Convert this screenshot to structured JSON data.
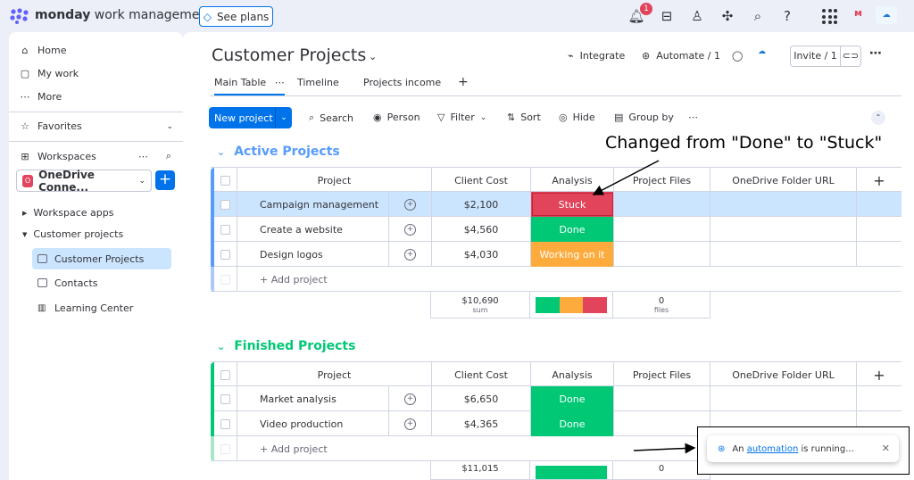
{
  "topbar": {
    "brand_bold": "monday",
    "brand_rest": " work management",
    "see_plans": "See plans",
    "notification_count": "1",
    "icons": [
      "bell-icon",
      "inbox-icon",
      "invite-members-icon",
      "apps-icon",
      "search-icon",
      "help-icon",
      "app-grid-icon"
    ]
  },
  "sidebar": {
    "home": "Home",
    "my_work": "My work",
    "more": "More",
    "favorites": "Favorites",
    "workspaces": "Workspaces",
    "workspace_name": "OneDrive Conne...",
    "workspace_badge": "O",
    "tree": {
      "workspace_apps": "Workspace apps",
      "customer_projects_folder": "Customer projects"
    },
    "boards": [
      "Customer Projects",
      "Contacts",
      "Learning Center"
    ]
  },
  "board": {
    "title": "Customer Projects",
    "integrate": "Integrate",
    "automate": "Automate / 1",
    "invite": "Invite / 1",
    "tabs": [
      "Main Table",
      "Timeline",
      "Projects income"
    ],
    "toolbar": {
      "new_project": "New project",
      "search": "Search",
      "person": "Person",
      "filter": "Filter",
      "sort": "Sort",
      "hide": "Hide",
      "group_by": "Group by"
    },
    "columns": {
      "project": "Project",
      "client_cost": "Client Cost",
      "analysis": "Analysis",
      "project_files": "Project Files",
      "onedrive_url": "OneDrive Folder URL"
    },
    "add_project": "+ Add project",
    "groups": [
      {
        "title": "Active Projects",
        "color": "#579bfc",
        "rows": [
          {
            "name": "Campaign management",
            "cost": "$2,100",
            "status": "Stuck"
          },
          {
            "name": "Create a website",
            "cost": "$4,560",
            "status": "Done"
          },
          {
            "name": "Design logos",
            "cost": "$4,030",
            "status": "Working on it"
          }
        ],
        "sum_value": "$10,690",
        "sum_label": "sum",
        "files_count": "0",
        "files_label": "files"
      },
      {
        "title": "Finished Projects",
        "color": "#00c875",
        "rows": [
          {
            "name": "Market analysis",
            "cost": "$6,650",
            "status": "Done"
          },
          {
            "name": "Video production",
            "cost": "$4,365",
            "status": "Done"
          }
        ],
        "sum_value": "$11,015",
        "files_count": "0"
      }
    ]
  },
  "annotation": {
    "text": "Changed from \"Done\" to \"Stuck\""
  },
  "toast": {
    "prefix": "An ",
    "link": "automation",
    "suffix": " is running..."
  },
  "colors": {
    "primary": "#0073ea",
    "stuck": "#e2445c",
    "done": "#00c875",
    "working": "#fdab3d"
  }
}
